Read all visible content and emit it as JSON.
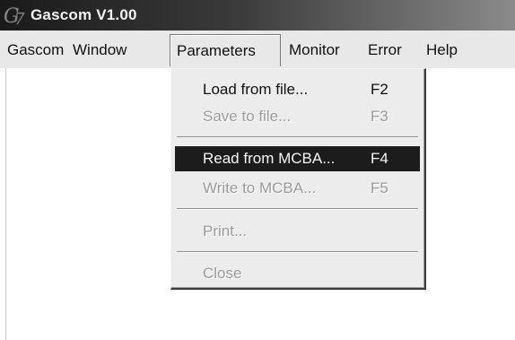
{
  "window": {
    "title": "Gascom V1.00",
    "icon": "gascom-logo-icon"
  },
  "menubar": {
    "items": [
      {
        "label": "Gascom"
      },
      {
        "label": "Window"
      },
      {
        "label": "Parameters"
      },
      {
        "label": "Monitor"
      },
      {
        "label": "Error"
      },
      {
        "label": "Help"
      }
    ],
    "open_menu": "Parameters"
  },
  "parameters_menu": {
    "items": [
      {
        "label": "Load from file...",
        "shortcut": "F2",
        "enabled": true,
        "highlighted": false
      },
      {
        "label": "Save to file...",
        "shortcut": "F3",
        "enabled": false,
        "highlighted": false
      },
      {
        "label": "Read from MCBA...",
        "shortcut": "F4",
        "enabled": true,
        "highlighted": true
      },
      {
        "label": "Write to MCBA...",
        "shortcut": "F5",
        "enabled": false,
        "highlighted": false
      },
      {
        "label": "Print...",
        "shortcut": "",
        "enabled": false,
        "highlighted": false
      },
      {
        "label": "Close",
        "shortcut": "",
        "enabled": false,
        "highlighted": false
      }
    ]
  },
  "colors": {
    "highlight_bg": "#1c1c1c",
    "menu_bg": "#ececec",
    "disabled_text": "#9b9b9b"
  }
}
